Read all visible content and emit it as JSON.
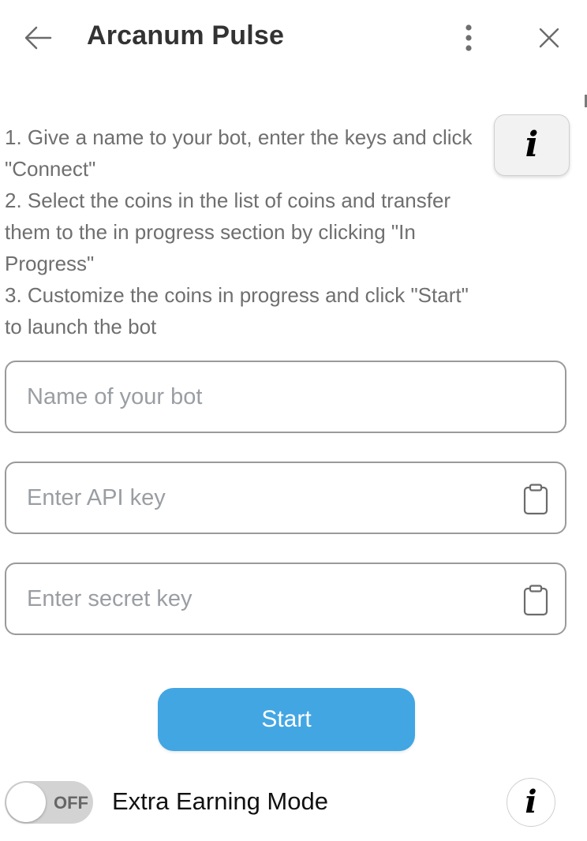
{
  "header": {
    "title": "Arcanum Pulse",
    "back_icon": "arrow-left-icon",
    "menu_icon": "more-vertical-icon",
    "close_icon": "close-icon"
  },
  "instructions": {
    "lines": [
      "1. Give a name to your bot, enter the keys and click \"Connect\"",
      "2. Select the coins in the list of coins and transfer them to the in progress section by clicking \"In Progress\"",
      "3. Customize the coins in progress and click \"Start\" to launch the bot"
    ],
    "info_icon": "info-icon",
    "info_glyph": "i"
  },
  "form": {
    "bot_name": {
      "value": "",
      "placeholder": "Name of your bot"
    },
    "api_key": {
      "value": "",
      "placeholder": "Enter API key",
      "icon": "clipboard-icon"
    },
    "secret_key": {
      "value": "",
      "placeholder": "Enter secret key",
      "icon": "clipboard-icon"
    }
  },
  "start_button": {
    "label": "Start"
  },
  "extra_mode": {
    "toggle_state": "OFF",
    "label": "Extra Earning Mode",
    "info_glyph": "i",
    "info_icon": "info-icon"
  },
  "colors": {
    "accent": "#42a6e3",
    "title_text": "#333333",
    "instruction_text": "#6f6f6f",
    "field_border": "#9a9a9a",
    "placeholder_text": "#9a9ea3",
    "toggle_off_bg": "#d3d3d3"
  }
}
